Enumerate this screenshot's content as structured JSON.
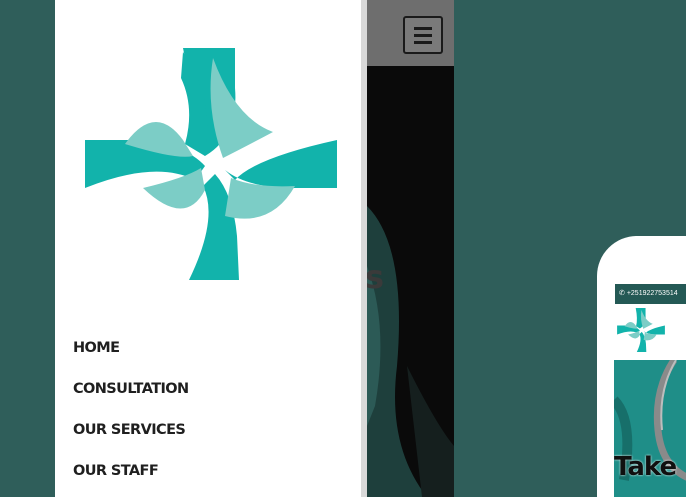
{
  "colors": {
    "background": "#2f5e5a",
    "brand": "#12b3ab",
    "brand_light": "#7ccdc6"
  },
  "drawer": {
    "logo_icon": "medical-cross-logo",
    "menu": [
      {
        "label": "HOME"
      },
      {
        "label": "CONSULTATION"
      },
      {
        "label": "OUR SERVICES"
      },
      {
        "label": "OUR STAFF"
      }
    ]
  },
  "page_behind": {
    "menu_icon": "hamburger-icon",
    "hero_fragment": "s"
  },
  "phone2": {
    "phone_icon": "phone-icon",
    "phone_number": "+251922753514",
    "logo_icon": "medical-cross-logo",
    "hero_title": "Take"
  }
}
